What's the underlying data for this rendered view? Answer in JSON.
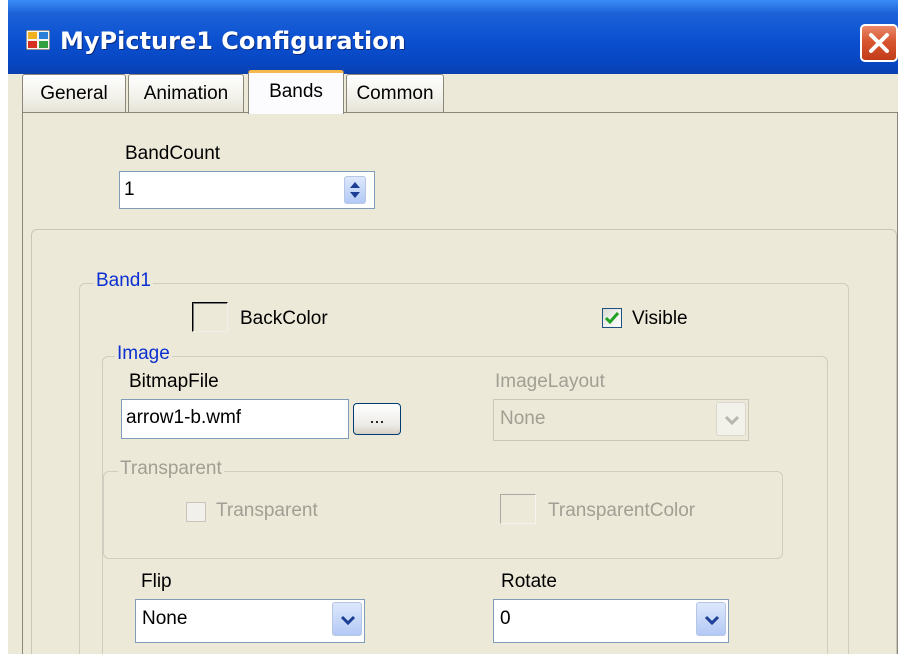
{
  "window": {
    "title": "MyPicture1 Configuration"
  },
  "tabs": [
    {
      "label": "General",
      "active": false
    },
    {
      "label": "Animation",
      "active": false
    },
    {
      "label": "Bands",
      "active": true
    },
    {
      "label": "Common",
      "active": false
    }
  ],
  "band_count": {
    "label": "BandCount",
    "value": "1"
  },
  "band1": {
    "legend": "Band1",
    "backcolor_label": "BackColor",
    "visible_label": "Visible",
    "visible_checked": true,
    "image": {
      "legend": "Image",
      "bitmap_label": "BitmapFile",
      "bitmap_value": "arrow1-b.wmf",
      "browse_label": "...",
      "image_layout_label": "ImageLayout",
      "image_layout_value": "None",
      "transparent_group": {
        "legend": "Transparent",
        "checkbox_label": "Transparent",
        "color_label": "TransparentColor"
      },
      "flip_label": "Flip",
      "flip_value": "None",
      "rotate_label": "Rotate",
      "rotate_value": "0"
    }
  },
  "colors": {
    "title_bar": "#0a50d0",
    "group_legend": "#0b2fd1",
    "dialog_bg": "#ece9d8",
    "checkmark": "#21a121",
    "close_button": "#d8562f"
  }
}
